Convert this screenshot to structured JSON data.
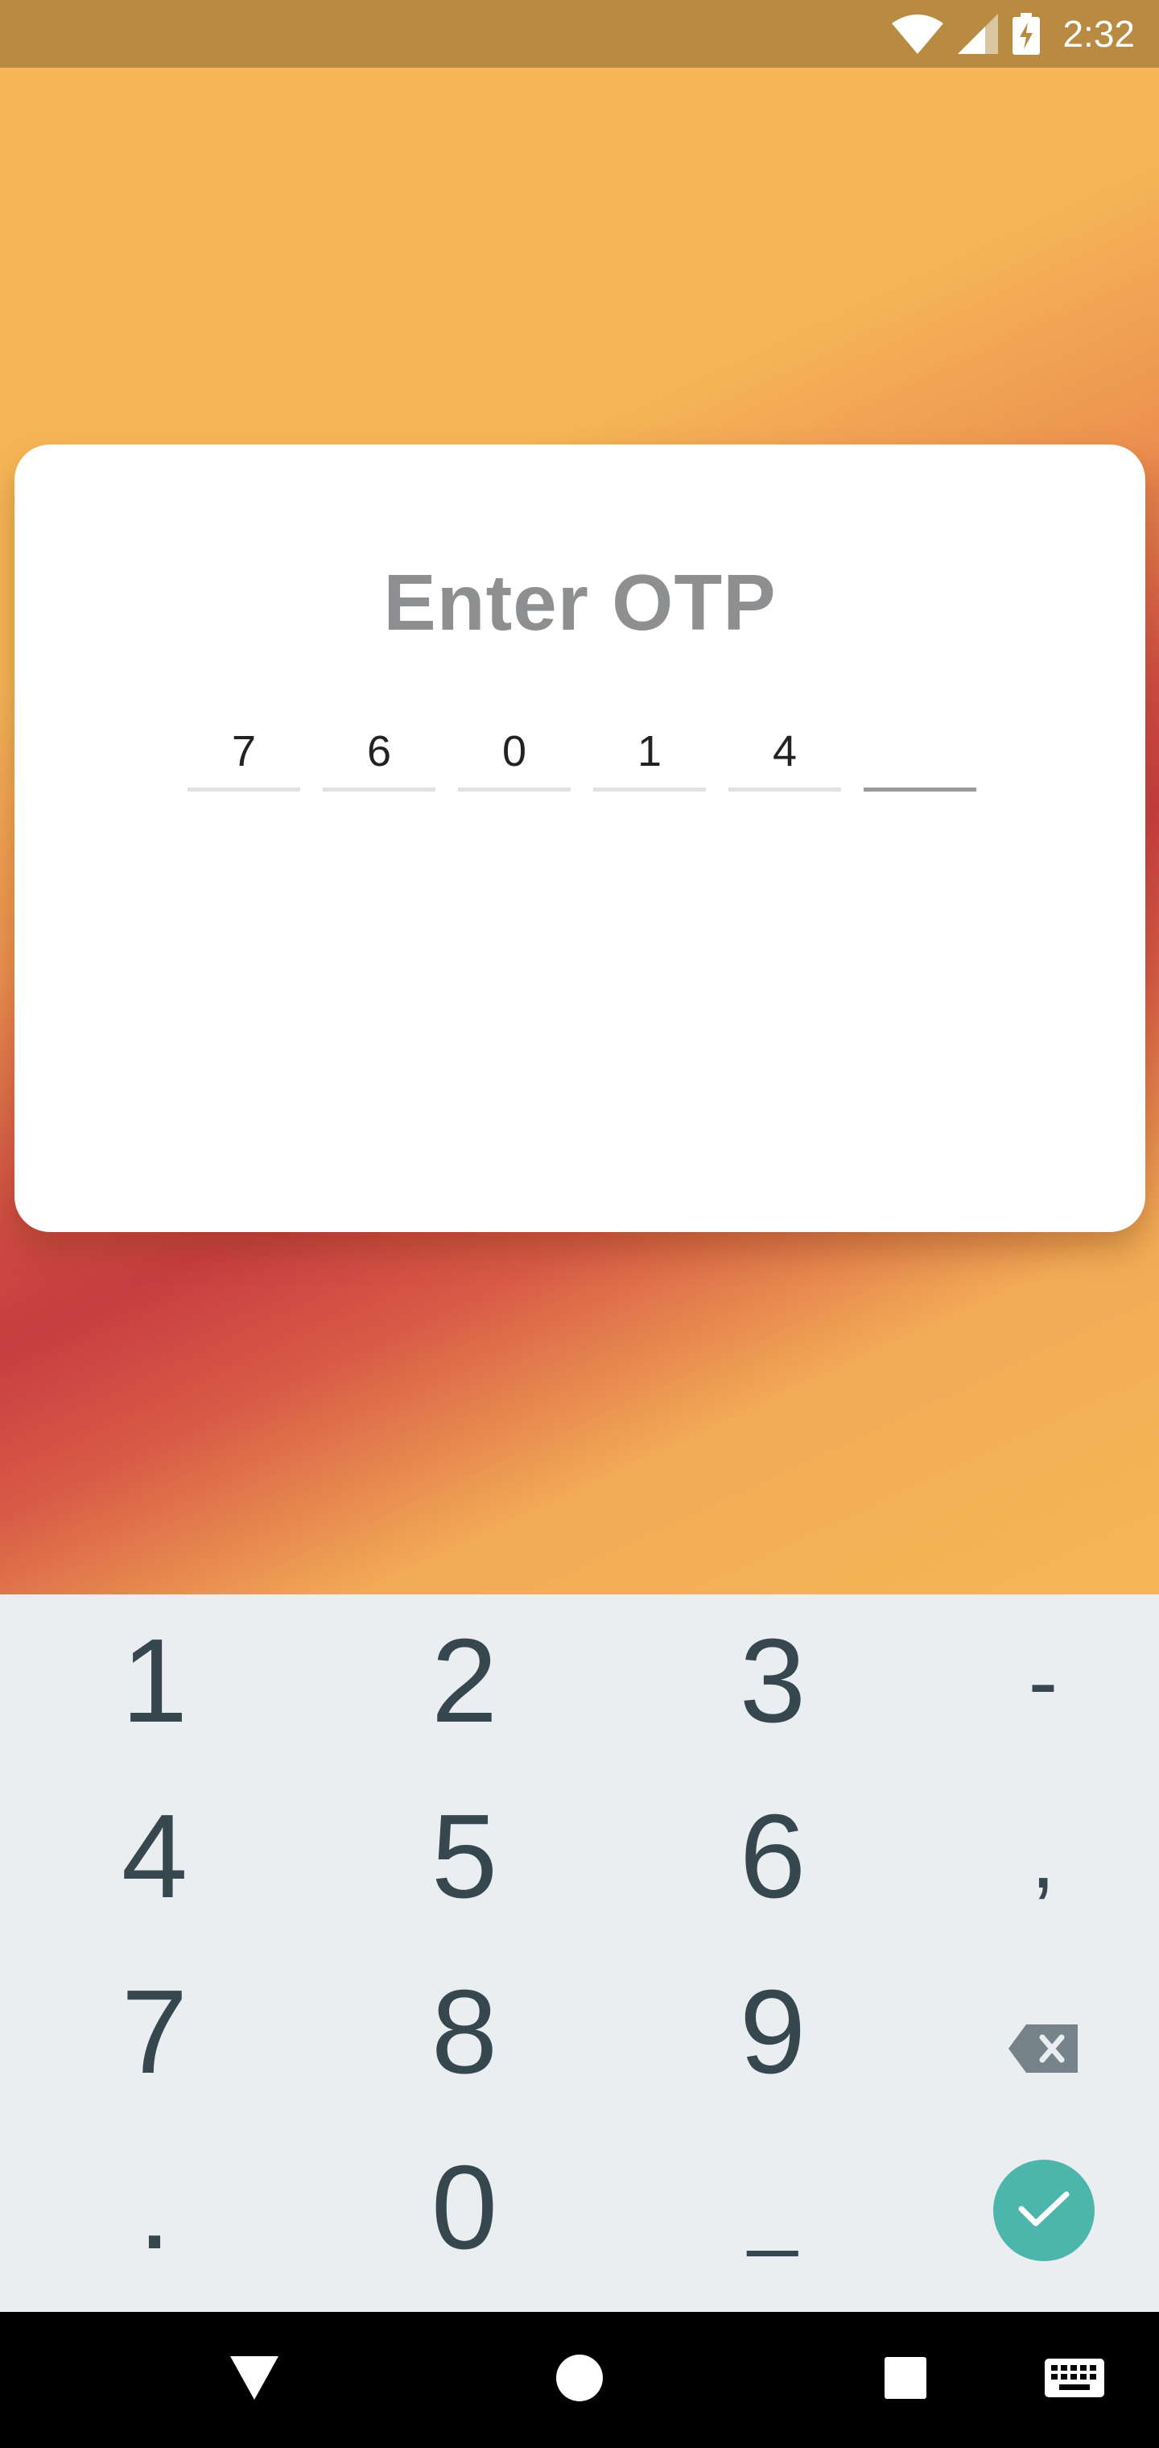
{
  "status_bar": {
    "time": "2:32",
    "icons": [
      "wifi-icon",
      "signal-icon",
      "battery-charging-icon"
    ]
  },
  "card": {
    "title": "Enter OTP",
    "otp_digits": [
      "7",
      "6",
      "0",
      "1",
      "4",
      ""
    ],
    "active_index": 5
  },
  "keyboard": {
    "rows": [
      [
        "1",
        "2",
        "3",
        "-"
      ],
      [
        "4",
        "5",
        "6",
        ","
      ],
      [
        "7",
        "8",
        "9",
        "backspace-icon"
      ],
      [
        ".",
        "0",
        "_",
        "done-icon"
      ]
    ],
    "accent_color": "#4db6ac"
  },
  "nav_bar": {
    "items": [
      "back-icon",
      "home-icon",
      "recents-icon",
      "keyboard-icon"
    ]
  },
  "colors": {
    "status_bar": "#b98a42",
    "background_orange": "#f6b657",
    "background_red": "#c83d41",
    "title_gray": "#8e8f90",
    "key_text": "#37474f"
  }
}
